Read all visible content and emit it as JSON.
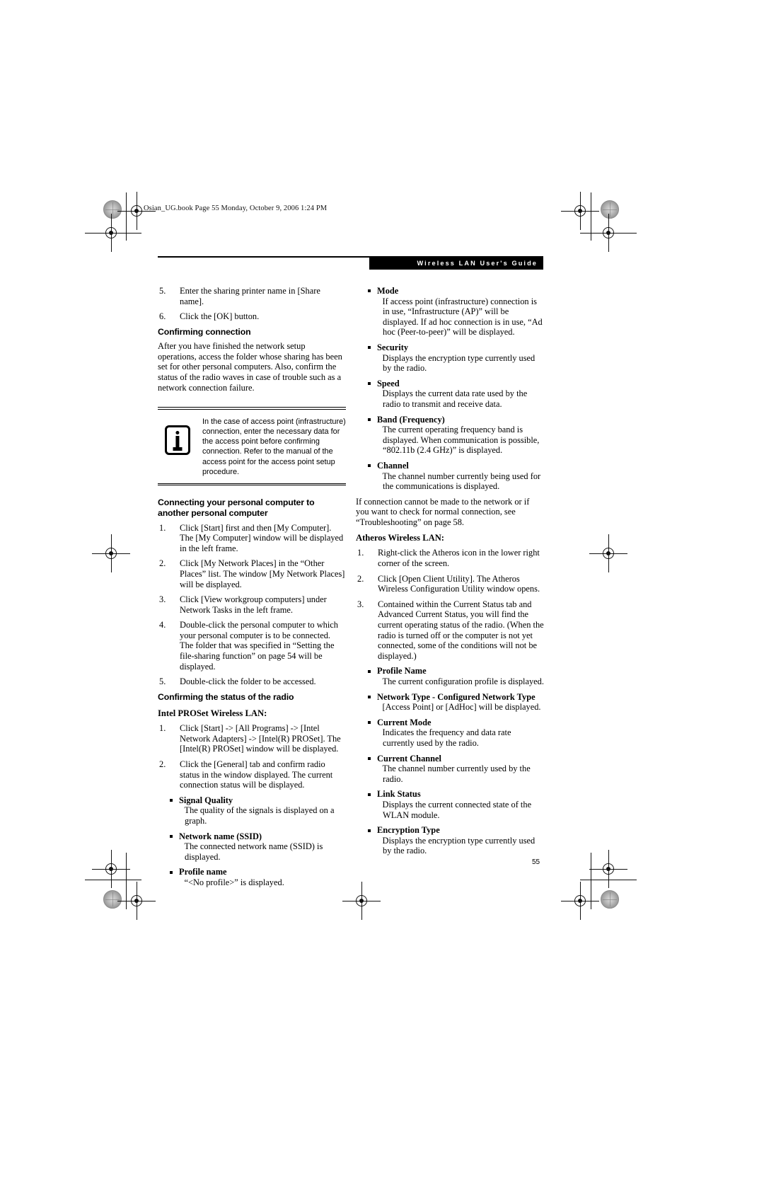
{
  "slug": "Osian_UG.book  Page 55  Monday, October 9, 2006  1:24 PM",
  "header": {
    "banner_title": "Wireless LAN User's Guide"
  },
  "footer": {
    "page_number": "55"
  },
  "left_column": {
    "steps_top": [
      {
        "n": "5.",
        "text": "Enter the sharing printer name in [Share name]."
      },
      {
        "n": "6.",
        "text": "Click the [OK] button."
      }
    ],
    "heading_confirming_connection": "Confirming connection",
    "para_confirming_connection": "After you have finished the network setup operations, access the folder whose sharing has been set for other personal computers. Also, confirm the status of the radio waves in case of trouble such as a network connection failure.",
    "note": {
      "icon": "information-icon",
      "text": "In the case of access point (infrastructure) connection, enter the necessary data for the access point before confirming connection. Refer to the manual of the access point for the access point setup procedure."
    },
    "heading_connecting": "Connecting your personal computer to another personal computer",
    "steps_connecting": [
      {
        "n": "1.",
        "text": "Click [Start] first and then [My Computer]. The [My Computer] window will be displayed in the left frame."
      },
      {
        "n": "2.",
        "text": "Click [My Network Places] in the “Other Places” list. The window [My Network Places] will be displayed."
      },
      {
        "n": "3.",
        "text": "Click [View workgroup computers] under Network Tasks in the left frame."
      },
      {
        "n": "4.",
        "text": " Double-click the personal computer to which your personal computer is to be connected. The folder that was specified in “Setting the file-sharing function” on page 54 will be displayed."
      },
      {
        "n": "5.",
        "text": "Double-click the folder to be accessed."
      }
    ],
    "heading_radio_status": "Confirming the status of the radio",
    "subheading_intel": "Intel PROSet Wireless LAN:",
    "steps_intel": [
      {
        "n": "1.",
        "text": "Click [Start] -> [All Programs] -> [Intel Network Adapters] -> [Intel(R) PROSet]. The [Intel(R) PROSet] window will be displayed."
      },
      {
        "n": "2.",
        "text": "Click the [General] tab and confirm radio status in the window displayed. The current connection status will be displayed."
      }
    ],
    "intel_items": [
      {
        "term": "Signal Quality",
        "desc": "The quality of the signals is displayed on a graph."
      },
      {
        "term": "Network name (SSID)",
        "desc": "The connected network name (SSID) is displayed."
      },
      {
        "term": "Profile name",
        "desc": "“<No profile>” is displayed."
      }
    ]
  },
  "right_column": {
    "intel_items_cont": [
      {
        "term": "Mode",
        "desc": "If access point (infrastructure) connection is in use, “Infrastructure (AP)” will be displayed. If ad hoc connection is in use, “Ad hoc (Peer-to-peer)” will be displayed."
      },
      {
        "term": "Security",
        "desc": "Displays the encryption type currently used by the radio."
      },
      {
        "term": "Speed",
        "desc": "Displays the current data rate used by the radio to transmit and receive data."
      },
      {
        "term": "Band (Frequency)",
        "desc": "The current operating frequency band is displayed. When communication is possible, “802.11b (2.4 GHz)” is displayed."
      },
      {
        "term": "Channel",
        "desc": "The channel number currently being used for the communications is displayed."
      }
    ],
    "para_troubleshooting": "If connection cannot be made to the network or if you want to check for normal connection, see “Troubleshooting” on page 58.",
    "subheading_atheros": "Atheros Wireless LAN:",
    "steps_atheros": [
      {
        "n": "1.",
        "text": " Right-click the Atheros icon in the lower right corner of the screen."
      },
      {
        "n": "2.",
        "text": "Click [Open Client Utility]. The Atheros Wireless Configuration Utility window opens."
      },
      {
        "n": "3.",
        "text": "Contained within the Current Status tab and Advanced Current Status, you will find the current operating status of the radio. (When the radio is turned off or the computer is not yet connected, some of the conditions will not be displayed.)"
      }
    ],
    "atheros_items": [
      {
        "term": "Profile Name",
        "desc": "The current configuration profile is displayed."
      },
      {
        "term": "Network Type - Configured Network Type",
        "desc": "[Access Point] or [AdHoc] will be displayed."
      },
      {
        "term": "Current Mode",
        "desc": "Indicates the frequency and data rate currently used by the radio."
      },
      {
        "term": "Current Channel",
        "desc": "The channel number currently used by the radio."
      },
      {
        "term": "Link Status",
        "desc": "Displays the current connected state of the WLAN module."
      },
      {
        "term": "Encryption Type",
        "desc": "Displays the encryption type currently used by the radio."
      }
    ]
  }
}
